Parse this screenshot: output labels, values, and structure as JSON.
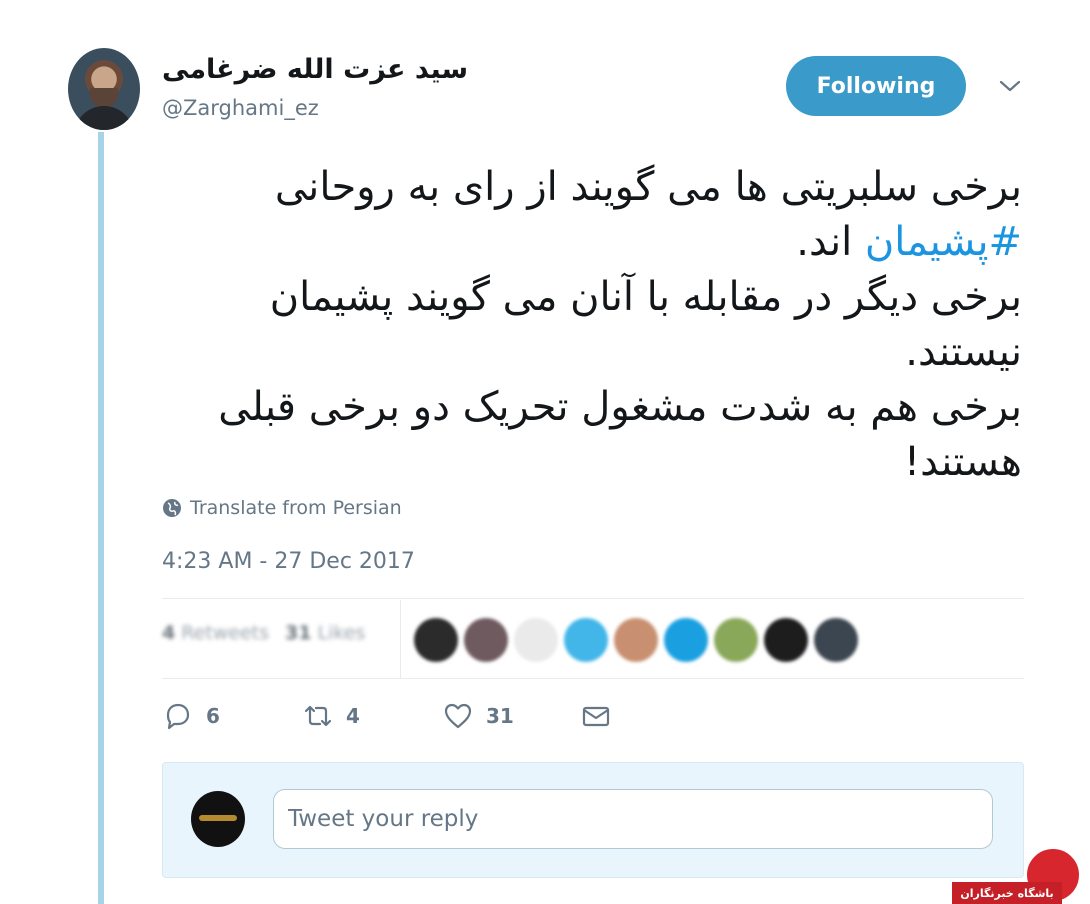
{
  "author": {
    "display_name": "سید عزت الله ضرغامی",
    "handle": "@Zarghami_ez"
  },
  "follow_button_label": "Following",
  "tweet": {
    "text_before_hashtag": "برخی سلبریتی ها می گویند از رای به روحانی ",
    "hashtag": "#پشیمان",
    "text_after_hashtag": " اند.\nبرخی دیگر در مقابله با آنان می گویند پشیمان نیستند.\nبرخی هم به شدت مشغول تحریک دو برخی قبلی هستند!"
  },
  "translate_label": "Translate from Persian",
  "timestamp": "4:23 AM - 27 Dec 2017",
  "stats": {
    "retweets_count": "4",
    "retweets_label": "Retweets",
    "likes_count": "31",
    "likes_label": "Likes"
  },
  "likers_avatar_colors": [
    "#2b2b2b",
    "#6f5a5f",
    "#eaeaea",
    "#42b6e8",
    "#c89070",
    "#1aa0e0",
    "#8aa85a",
    "#1d1d1d",
    "#3c4650"
  ],
  "actions": {
    "reply_count": "6",
    "retweet_count": "4",
    "like_count": "31"
  },
  "reply": {
    "placeholder": "Tweet your reply"
  },
  "watermark_text": "باشگاه خبرنگاران",
  "colors": {
    "accent": "#3a9ac9",
    "hashtag": "#1b95e0",
    "thread_line": "#a7d3e6",
    "muted": "#657786"
  }
}
